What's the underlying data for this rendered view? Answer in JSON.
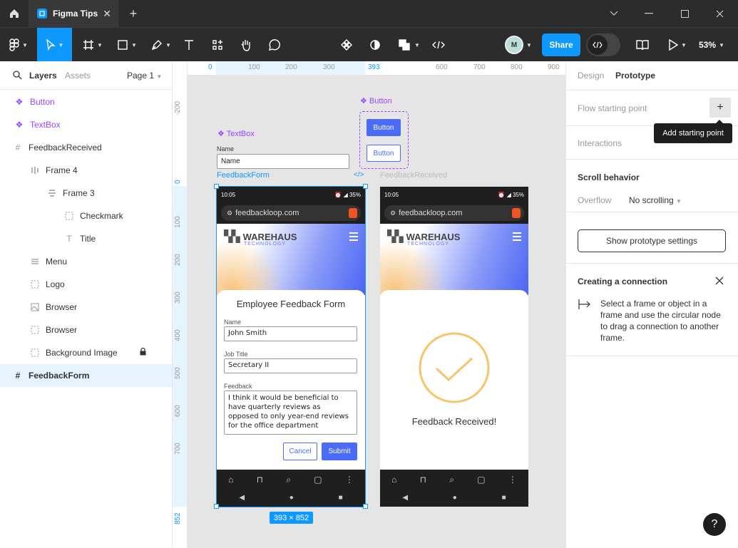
{
  "window": {
    "tab_title": "Figma Tips"
  },
  "toolbar": {
    "share_label": "Share",
    "zoom": "53%"
  },
  "left_panel": {
    "tabs": {
      "layers": "Layers",
      "assets": "Assets",
      "page": "Page 1"
    },
    "layers": [
      {
        "label": "Button"
      },
      {
        "label": "TextBox"
      },
      {
        "label": "FeedbackReceived"
      },
      {
        "label": "Frame 4"
      },
      {
        "label": "Frame 3"
      },
      {
        "label": "Checkmark"
      },
      {
        "label": "Title"
      },
      {
        "label": "Menu"
      },
      {
        "label": "Logo"
      },
      {
        "label": "Browser"
      },
      {
        "label": "Browser"
      },
      {
        "label": "Background Image"
      },
      {
        "label": "FeedbackForm"
      }
    ]
  },
  "rulers": {
    "top": [
      "0",
      "100",
      "200",
      "300",
      "393",
      "600",
      "700",
      "800",
      "900"
    ],
    "left": [
      "-200",
      "0",
      "100",
      "200",
      "300",
      "400",
      "500",
      "600",
      "700",
      "852"
    ]
  },
  "canvas": {
    "button_component": {
      "label": "Button",
      "primary": "Button",
      "secondary": "Button"
    },
    "textbox_component": {
      "label": "TextBox",
      "field_label": "Name",
      "placeholder": "Name"
    },
    "frame1": {
      "label": "FeedbackForm",
      "size_badge": "393 × 852",
      "time": "10:05",
      "battery": "35%",
      "url": "feedbackloop.com",
      "logo_main": "WAREHAUS",
      "logo_sub": "TECHNOLOGY",
      "form_title": "Employee Feedback Form",
      "name_label": "Name",
      "name_value": "John Smith",
      "job_label": "Job Title",
      "job_value": "Secretary II",
      "feedback_label": "Feedback",
      "feedback_value": "I think it would be beneficial to have quarterly reviews as opposed to only year-end reviews for the office department",
      "cancel_label": "Cancel",
      "submit_label": "Submit"
    },
    "frame2": {
      "label": "FeedbackReceived",
      "time": "10:05",
      "battery": "35%",
      "url": "feedbackloop.com",
      "logo_main": "WAREHAUS",
      "logo_sub": "TECHNOLOGY",
      "message": "Feedback Received!"
    }
  },
  "right_panel": {
    "tabs": {
      "design": "Design",
      "prototype": "Prototype"
    },
    "flow_starting_point": "Flow starting point",
    "tooltip": "Add starting point",
    "interactions": "Interactions",
    "scroll_behavior": "Scroll behavior",
    "overflow_label": "Overflow",
    "overflow_value": "No scrolling",
    "show_settings": "Show prototype settings",
    "connection_title": "Creating a connection",
    "connection_text": "Select a frame or object in a frame and use the circular node to drag a connection to another frame."
  },
  "colors": {
    "accent": "#0d99ff",
    "component": "#9747ff",
    "form_button": "#4a6cf7",
    "check": "#f6c46b"
  },
  "help": "?"
}
